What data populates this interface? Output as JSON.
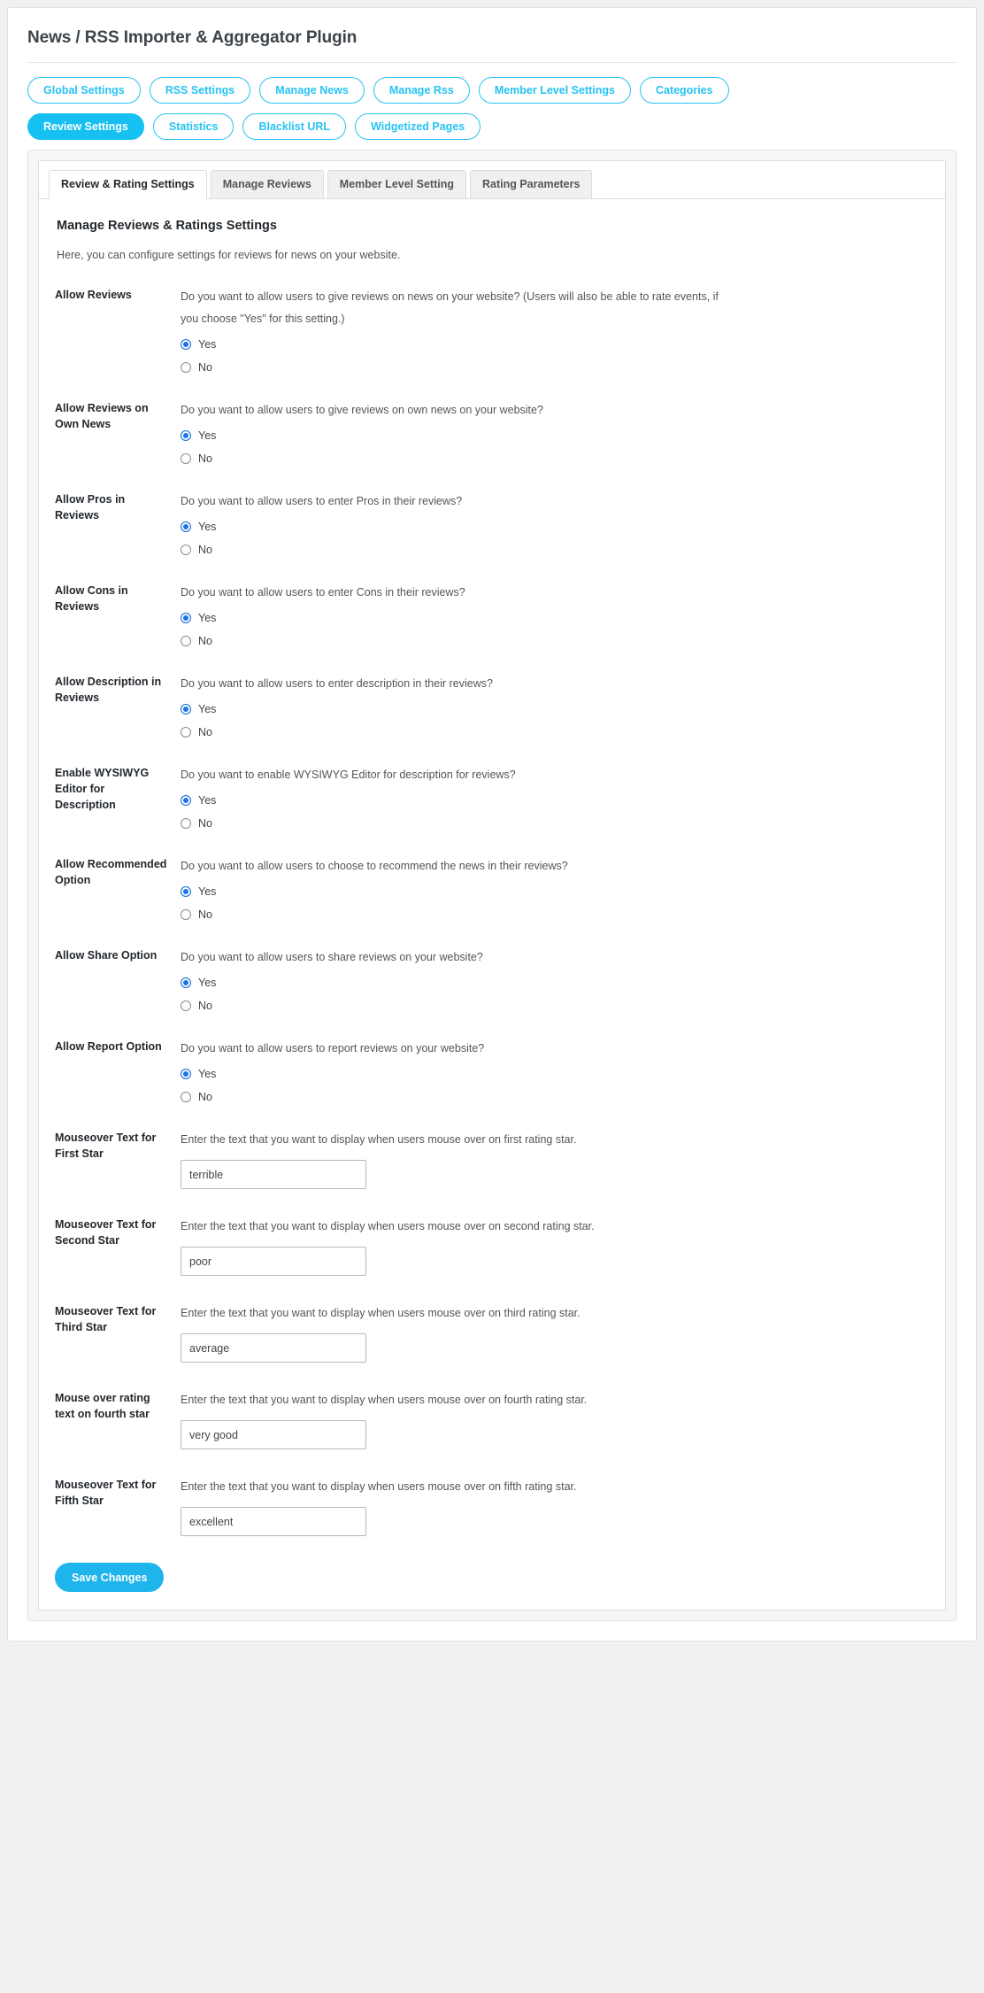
{
  "header": {
    "title": "News / RSS Importer & Aggregator Plugin"
  },
  "pill_nav": {
    "rows": [
      [
        {
          "label": "Global Settings",
          "active": false
        },
        {
          "label": "RSS Settings",
          "active": false
        },
        {
          "label": "Manage News",
          "active": false
        },
        {
          "label": "Manage Rss",
          "active": false
        },
        {
          "label": "Member Level Settings",
          "active": false
        },
        {
          "label": "Categories",
          "active": false
        }
      ],
      [
        {
          "label": "Review Settings",
          "active": true
        },
        {
          "label": "Statistics",
          "active": false
        },
        {
          "label": "Blacklist URL",
          "active": false
        },
        {
          "label": "Widgetized Pages",
          "active": false
        }
      ]
    ]
  },
  "tabs": [
    {
      "label": "Review & Rating Settings",
      "active": true
    },
    {
      "label": "Manage Reviews",
      "active": false
    },
    {
      "label": "Member Level Setting",
      "active": false
    },
    {
      "label": "Rating Parameters",
      "active": false
    }
  ],
  "panel": {
    "section_title": "Manage Reviews & Ratings Settings",
    "section_desc": "Here, you can configure settings for reviews for news on your website."
  },
  "settings": [
    {
      "label": "Allow Reviews",
      "description": "Do you want to allow users to give reviews on news on your website? (Users will also be able to rate events, if you choose \"Yes\" for this setting.)",
      "type": "radio",
      "options": [
        {
          "label": "Yes",
          "checked": true
        },
        {
          "label": "No",
          "checked": false
        }
      ]
    },
    {
      "label": "Allow Reviews on Own News",
      "description": "Do you want to allow users to give reviews on own news on your website?",
      "type": "radio",
      "options": [
        {
          "label": "Yes",
          "checked": true
        },
        {
          "label": "No",
          "checked": false
        }
      ]
    },
    {
      "label": "Allow Pros in Reviews",
      "description": "Do you want to allow users to enter Pros in their reviews?",
      "type": "radio",
      "options": [
        {
          "label": "Yes",
          "checked": true
        },
        {
          "label": "No",
          "checked": false
        }
      ]
    },
    {
      "label": "Allow Cons in Reviews",
      "description": "Do you want to allow users to enter Cons in their reviews?",
      "type": "radio",
      "options": [
        {
          "label": "Yes",
          "checked": true
        },
        {
          "label": "No",
          "checked": false
        }
      ]
    },
    {
      "label": "Allow Description in Reviews",
      "description": "Do you want to allow users to enter description in their reviews?",
      "type": "radio",
      "options": [
        {
          "label": "Yes",
          "checked": true
        },
        {
          "label": "No",
          "checked": false
        }
      ]
    },
    {
      "label": "Enable WYSIWYG Editor for Description",
      "description": "Do you want to enable WYSIWYG Editor for description for reviews?",
      "type": "radio",
      "options": [
        {
          "label": "Yes",
          "checked": true
        },
        {
          "label": "No",
          "checked": false
        }
      ]
    },
    {
      "label": "Allow Recommended Option",
      "description": "Do you want to allow users to choose to recommend the news in their reviews?",
      "type": "radio",
      "options": [
        {
          "label": "Yes",
          "checked": true
        },
        {
          "label": "No",
          "checked": false
        }
      ]
    },
    {
      "label": "Allow Share Option",
      "description": "Do you want to allow users to share reviews on your website?",
      "type": "radio",
      "options": [
        {
          "label": "Yes",
          "checked": true
        },
        {
          "label": "No",
          "checked": false
        }
      ]
    },
    {
      "label": "Allow Report Option",
      "description": "Do you want to allow users to report reviews on your website?",
      "type": "radio",
      "options": [
        {
          "label": "Yes",
          "checked": true
        },
        {
          "label": "No",
          "checked": false
        }
      ]
    },
    {
      "label": "Mouseover Text for First Star",
      "description": "Enter the text that you want to display when users mouse over on first rating star.",
      "type": "text",
      "value": "terrible"
    },
    {
      "label": "Mouseover Text for Second Star",
      "description": "Enter the text that you want to display when users mouse over on second rating star.",
      "type": "text",
      "value": "poor"
    },
    {
      "label": "Mouseover Text for Third Star",
      "description": "Enter the text that you want to display when users mouse over on third rating star.",
      "type": "text",
      "value": "average"
    },
    {
      "label": "Mouse over rating text on fourth star",
      "description": "Enter the text that you want to display when users mouse over on fourth rating star.",
      "type": "text",
      "value": "very good"
    },
    {
      "label": "Mouseover Text for Fifth Star",
      "description": "Enter the text that you want to display when users mouse over on fifth rating star.",
      "type": "text",
      "value": "excellent"
    }
  ],
  "actions": {
    "save_label": "Save Changes"
  },
  "colors": {
    "accent_cyan": "#16c0f0",
    "pill_border": "#27c3f3",
    "save_blue": "#1eb4ec",
    "radio_blue": "#1a73e8"
  }
}
